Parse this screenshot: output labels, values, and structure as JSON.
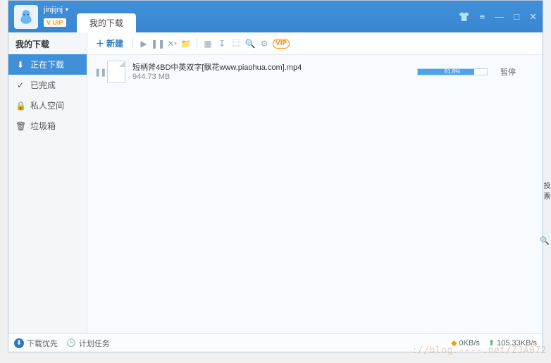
{
  "user": {
    "name": "jinjijnj",
    "vip_label": "V UIP"
  },
  "tabs": [
    {
      "label": "我的下载"
    }
  ],
  "window_controls": {
    "tshirt": "👕",
    "menu": "≡",
    "min": "—",
    "max": "□",
    "close": "✕"
  },
  "sidebar": {
    "heading": "我的下载",
    "items": [
      {
        "icon": "⬇",
        "label": "正在下载"
      },
      {
        "icon": "✓",
        "label": "已完成"
      },
      {
        "icon": "🔒",
        "label": "私人空间"
      },
      {
        "icon": "🗑",
        "label": "垃圾箱"
      }
    ]
  },
  "toolbar": {
    "new_label": "新建",
    "icons": {
      "play": "▶",
      "pause": "❚❚",
      "delete": "✕",
      "folder": "📁",
      "grid": "▦",
      "sort": "↧",
      "detail": "⿴",
      "search": "🔍",
      "settings": "⚙",
      "vip": "VIP"
    }
  },
  "downloads": [
    {
      "filename": "短柄斧4BD中英双字[飘花www.piaohua.com].mp4",
      "size": "944.73 MB",
      "percent": "81.8%",
      "percent_num": 81.8,
      "status": "暂停"
    }
  ],
  "footer": {
    "priority": "下载优先",
    "schedule": "计划任务",
    "down_speed": "0KB/s",
    "up_speed": "105.33KB/s"
  },
  "rstrip": {
    "vote": "投票"
  },
  "watermark": "://blog.----.net/ZJA072"
}
